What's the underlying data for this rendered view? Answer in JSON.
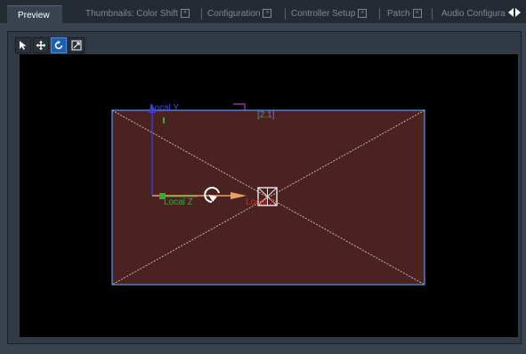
{
  "tabs": [
    {
      "label": "Preview",
      "active": true,
      "closable": false
    },
    {
      "label": "Thumbnails: Color Shift",
      "closable": true
    },
    {
      "label": "Configuration",
      "closable": true
    },
    {
      "label": "Controller Setup",
      "closable": true
    },
    {
      "label": "Patch",
      "closable": true
    },
    {
      "label": "Audio Configura",
      "closable": false
    }
  ],
  "toolbar": {
    "tools": [
      "select-arrow-icon",
      "move-icon",
      "rotate-icon",
      "scale-icon"
    ],
    "active_tool": "rotate-icon"
  },
  "viewport": {
    "labels": {
      "local_y": "Local Y",
      "local_z": "Local Z",
      "local_x": "Local X",
      "surface_id": "[2.1]"
    },
    "colors": {
      "surface_fill": "#4a2220",
      "surface_border": "#4b7fd0",
      "y_axis": "#3b3bd8",
      "z_axis": "#2fae3a",
      "x_axis": "#e8a060"
    }
  }
}
